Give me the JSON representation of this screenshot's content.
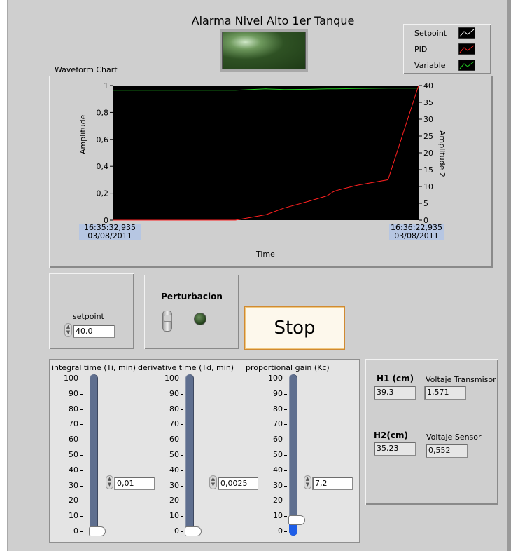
{
  "alarm": {
    "title": "Alarma Nivel Alto 1er Tanque"
  },
  "legend": {
    "items": [
      {
        "label": "Setpoint",
        "color": "#ffffff"
      },
      {
        "label": "PID",
        "color": "#ff2020"
      },
      {
        "label": "Variable",
        "color": "#22cc22"
      }
    ]
  },
  "chart": {
    "label": "Waveform Chart",
    "y_left_label": "Amplitude",
    "y_right_label": "Amplitude 2",
    "x_label": "Time",
    "y_left_ticks": [
      "1",
      "0,8",
      "0,6",
      "0,4",
      "0,2",
      "0"
    ],
    "y_right_ticks": [
      "40",
      "35",
      "30",
      "25",
      "20",
      "15",
      "10",
      "5",
      "0"
    ],
    "x_start_time": "16:35:32,935",
    "x_start_date": "03/08/2011",
    "x_end_time": "16:36:22,935",
    "x_end_date": "03/08/2011"
  },
  "chart_data": {
    "type": "line",
    "title": "Waveform Chart",
    "xlabel": "Time",
    "ylabel": "Amplitude",
    "y2label": "Amplitude 2",
    "xlim": [
      "16:35:32,935",
      "16:36:22,935"
    ],
    "ylim": [
      0,
      1
    ],
    "y2lim": [
      0,
      40
    ],
    "grid": false,
    "x_seconds": [
      0,
      5,
      10,
      15,
      20,
      25,
      28,
      32,
      35,
      36,
      36.5,
      40,
      45,
      50
    ],
    "series": [
      {
        "name": "Variable",
        "axis": "left",
        "values": [
          0.965,
          0.965,
          0.965,
          0.965,
          0.965,
          0.975,
          0.97,
          0.972,
          0.975,
          0.975,
          0.975,
          0.978,
          0.98,
          0.98
        ]
      },
      {
        "name": "PID",
        "axis": "left",
        "values": [
          0,
          0,
          0,
          0,
          0,
          0.04,
          0.09,
          0.14,
          0.18,
          0.21,
          0.22,
          0.26,
          0.3,
          1.0
        ]
      }
    ]
  },
  "setpoint": {
    "label": "setpoint",
    "value": "40,0"
  },
  "perturbacion": {
    "label": "Perturbacion"
  },
  "stop": {
    "label": "Stop"
  },
  "sliders": [
    {
      "label": "integral time (Ti, min)",
      "value": "0,01",
      "level": 0
    },
    {
      "label": "derivative time (Td, min)",
      "value": "0,0025",
      "level": 0
    },
    {
      "label": "proportional gain (Kc)",
      "value": "7,2",
      "level": 7.2
    }
  ],
  "slider_ticks": [
    "100",
    "90",
    "80",
    "70",
    "60",
    "50",
    "40",
    "30",
    "20",
    "10",
    "0"
  ],
  "readouts": {
    "h1_label": "H1 (cm)",
    "h1_value": "39,3",
    "vt_label": "Voltaje Transmisor",
    "vt_value": "1,571",
    "h2_label": "H2(cm)",
    "h2_value": "35,23",
    "vs_label": "Voltaje Sensor",
    "vs_value": "0,552"
  }
}
